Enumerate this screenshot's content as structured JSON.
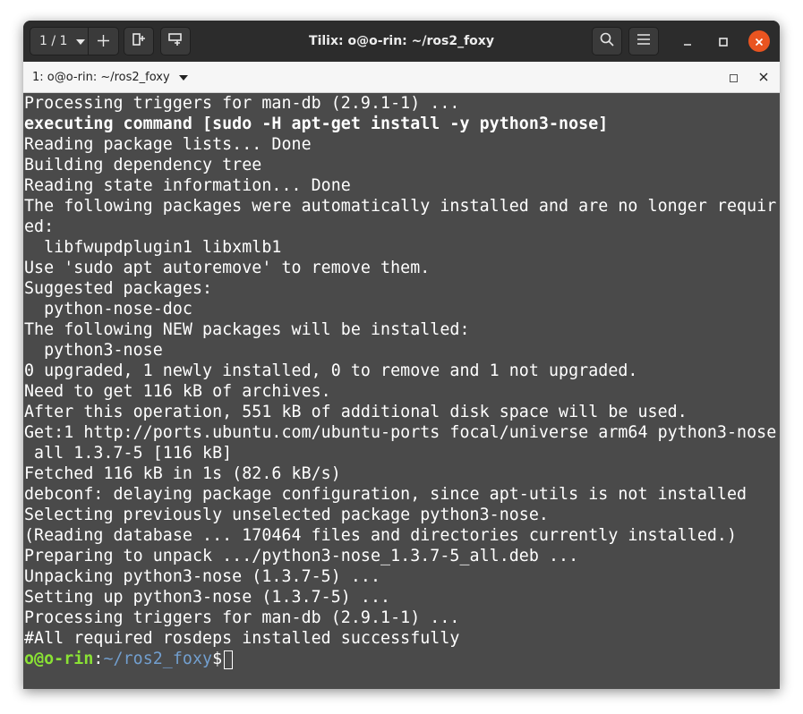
{
  "header": {
    "session_counter": "1 / 1",
    "title": "Tilix: o@o-rin: ~/ros2_foxy"
  },
  "tab": {
    "title": "1: o@o-rin: ~/ros2_foxy"
  },
  "terminal": {
    "lines": [
      "Processing triggers for man-db (2.9.1-1) ...",
      "executing command [sudo -H apt-get install -y python3-nose]",
      "Reading package lists... Done",
      "Building dependency tree",
      "Reading state information... Done",
      "The following packages were automatically installed and are no longer requir",
      "ed:",
      "  libfwupdplugin1 libxmlb1",
      "Use 'sudo apt autoremove' to remove them.",
      "Suggested packages:",
      "  python-nose-doc",
      "The following NEW packages will be installed:",
      "  python3-nose",
      "0 upgraded, 1 newly installed, 0 to remove and 1 not upgraded.",
      "Need to get 116 kB of archives.",
      "After this operation, 551 kB of additional disk space will be used.",
      "Get:1 http://ports.ubuntu.com/ubuntu-ports focal/universe arm64 python3-nose",
      " all 1.3.7-5 [116 kB]",
      "Fetched 116 kB in 1s (82.6 kB/s)",
      "debconf: delaying package configuration, since apt-utils is not installed",
      "Selecting previously unselected package python3-nose.",
      "(Reading database ... 170464 files and directories currently installed.)",
      "Preparing to unpack .../python3-nose_1.3.7-5_all.deb ...",
      "Unpacking python3-nose (1.3.7-5) ...",
      "Setting up python3-nose (1.3.7-5) ...",
      "Processing triggers for man-db (2.9.1-1) ...",
      "#All required rosdeps installed successfully"
    ],
    "prompt": {
      "user_host": "o@o-rin",
      "separator": ":",
      "path": "~/ros2_foxy",
      "symbol": "$"
    }
  },
  "colors": {
    "terminal_bg": "#4a4a4a",
    "header_bg": "#2c2c2c",
    "prompt_user": "#8ae234",
    "prompt_path": "#729fcf",
    "close_button": "#e95420"
  },
  "icons": [
    "chevron-down-icon",
    "plus-icon",
    "add-terminal-right-icon",
    "add-terminal-down-icon",
    "search-icon",
    "hamburger-menu-icon",
    "minimize-icon",
    "maximize-icon",
    "close-icon"
  ]
}
